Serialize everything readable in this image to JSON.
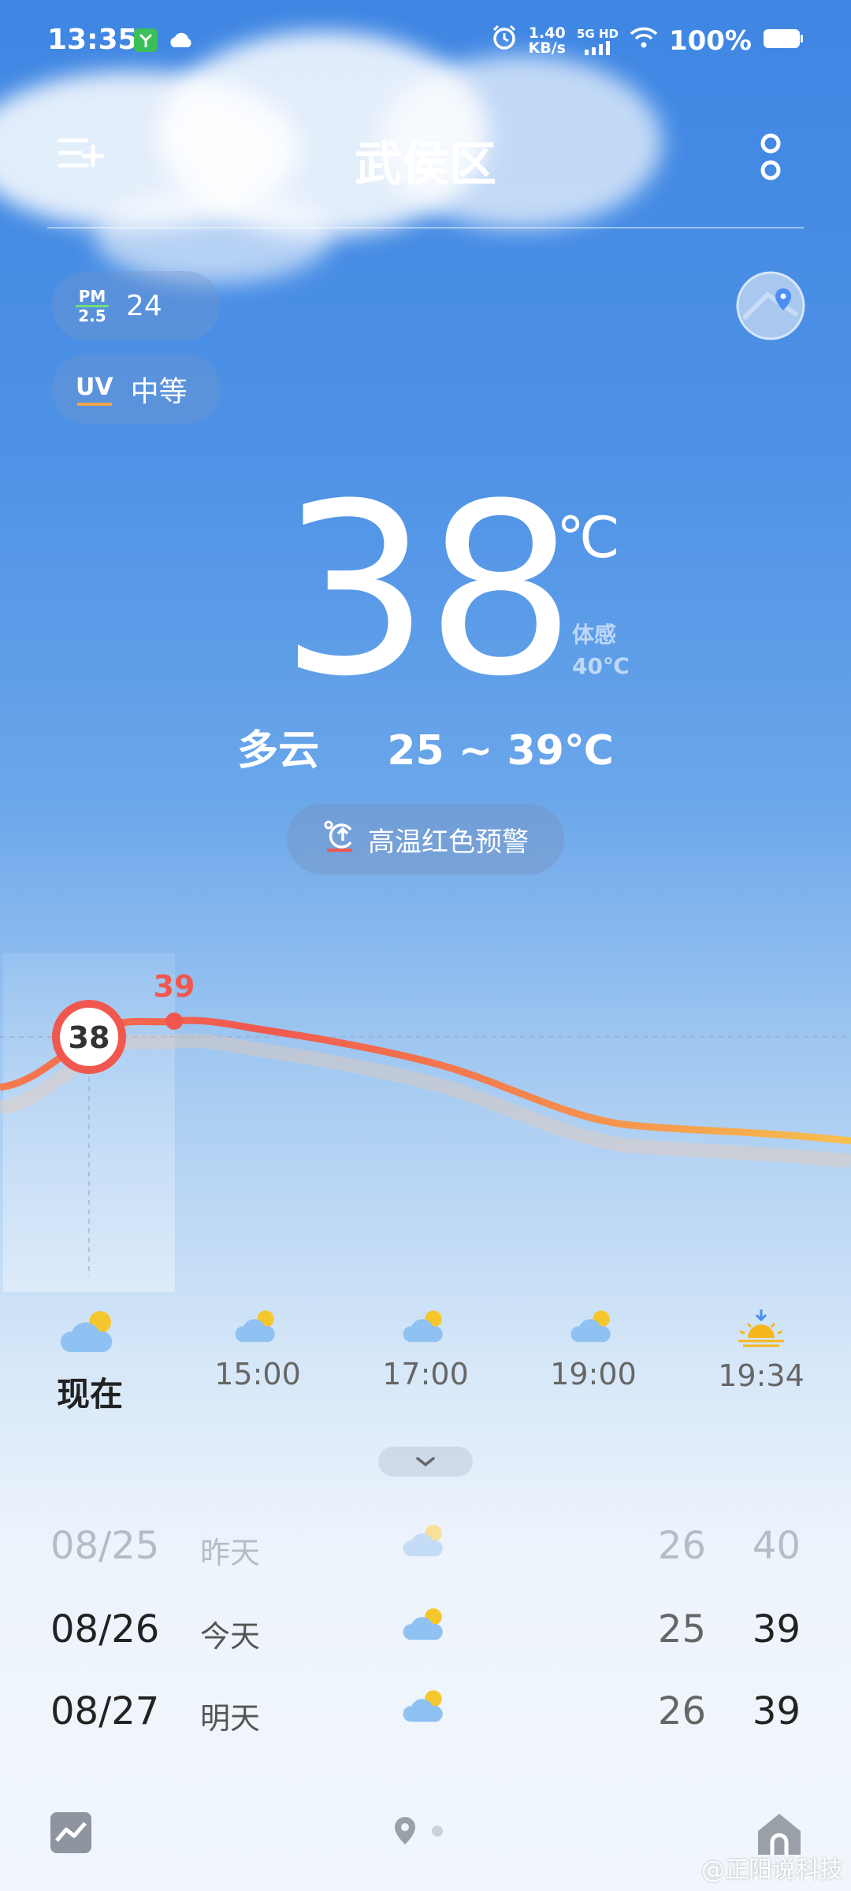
{
  "status_bar": {
    "time": "13:35",
    "speed_value": "1.40",
    "speed_unit": "KB/s",
    "network": "5G HD",
    "battery": "100%"
  },
  "header": {
    "city": "武侯区"
  },
  "indicators": {
    "pm_label_top": "PM",
    "pm_label_bottom": "2.5",
    "pm_value": "24",
    "uv_label": "UV",
    "uv_value": "中等"
  },
  "current": {
    "temp": "38",
    "unit": "℃",
    "feels_label": "体感",
    "feels_value": "40℃",
    "condition": "多云",
    "range": "25 ~ 39℃"
  },
  "alert": {
    "text": "高温红色预警"
  },
  "hourly": [
    {
      "label": "现在",
      "icon": "cloudy-sun-icon",
      "temp": 38
    },
    {
      "label": "15:00",
      "icon": "cloudy-sun-icon",
      "temp": 39
    },
    {
      "label": "17:00",
      "icon": "cloudy-sun-icon",
      "temp": null
    },
    {
      "label": "19:00",
      "icon": "cloudy-sun-icon",
      "temp": null
    },
    {
      "label": "19:34",
      "icon": "sunset-icon",
      "temp": null
    }
  ],
  "chart": {
    "now_value": "38",
    "peak_value": "39"
  },
  "daily": [
    {
      "date": "08/25",
      "name": "昨天",
      "low": "26",
      "high": "40"
    },
    {
      "date": "08/26",
      "name": "今天",
      "low": "25",
      "high": "39"
    },
    {
      "date": "08/27",
      "name": "明天",
      "low": "26",
      "high": "39"
    }
  ],
  "watermark": "@正阳说科技",
  "colors": {
    "accent_red": "#f0584f",
    "curve_orange": "#f7b24a"
  }
}
